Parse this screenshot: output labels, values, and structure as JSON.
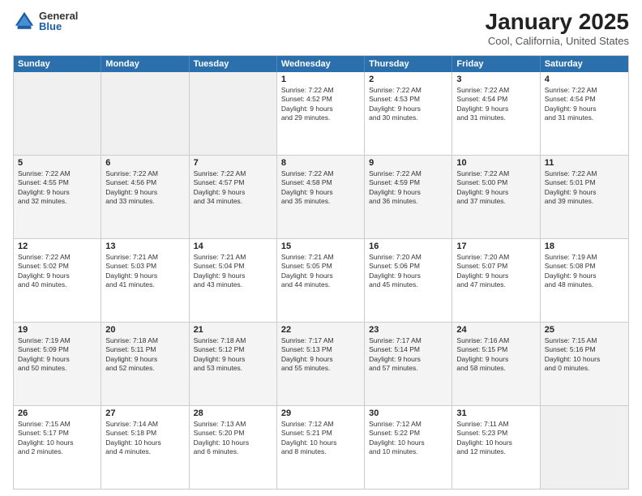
{
  "logo": {
    "general": "General",
    "blue": "Blue"
  },
  "title": "January 2025",
  "subtitle": "Cool, California, United States",
  "header_days": [
    "Sunday",
    "Monday",
    "Tuesday",
    "Wednesday",
    "Thursday",
    "Friday",
    "Saturday"
  ],
  "weeks": [
    [
      {
        "day": "",
        "text": ""
      },
      {
        "day": "",
        "text": ""
      },
      {
        "day": "",
        "text": ""
      },
      {
        "day": "1",
        "text": "Sunrise: 7:22 AM\nSunset: 4:52 PM\nDaylight: 9 hours\nand 29 minutes."
      },
      {
        "day": "2",
        "text": "Sunrise: 7:22 AM\nSunset: 4:53 PM\nDaylight: 9 hours\nand 30 minutes."
      },
      {
        "day": "3",
        "text": "Sunrise: 7:22 AM\nSunset: 4:54 PM\nDaylight: 9 hours\nand 31 minutes."
      },
      {
        "day": "4",
        "text": "Sunrise: 7:22 AM\nSunset: 4:54 PM\nDaylight: 9 hours\nand 31 minutes."
      }
    ],
    [
      {
        "day": "5",
        "text": "Sunrise: 7:22 AM\nSunset: 4:55 PM\nDaylight: 9 hours\nand 32 minutes."
      },
      {
        "day": "6",
        "text": "Sunrise: 7:22 AM\nSunset: 4:56 PM\nDaylight: 9 hours\nand 33 minutes."
      },
      {
        "day": "7",
        "text": "Sunrise: 7:22 AM\nSunset: 4:57 PM\nDaylight: 9 hours\nand 34 minutes."
      },
      {
        "day": "8",
        "text": "Sunrise: 7:22 AM\nSunset: 4:58 PM\nDaylight: 9 hours\nand 35 minutes."
      },
      {
        "day": "9",
        "text": "Sunrise: 7:22 AM\nSunset: 4:59 PM\nDaylight: 9 hours\nand 36 minutes."
      },
      {
        "day": "10",
        "text": "Sunrise: 7:22 AM\nSunset: 5:00 PM\nDaylight: 9 hours\nand 37 minutes."
      },
      {
        "day": "11",
        "text": "Sunrise: 7:22 AM\nSunset: 5:01 PM\nDaylight: 9 hours\nand 39 minutes."
      }
    ],
    [
      {
        "day": "12",
        "text": "Sunrise: 7:22 AM\nSunset: 5:02 PM\nDaylight: 9 hours\nand 40 minutes."
      },
      {
        "day": "13",
        "text": "Sunrise: 7:21 AM\nSunset: 5:03 PM\nDaylight: 9 hours\nand 41 minutes."
      },
      {
        "day": "14",
        "text": "Sunrise: 7:21 AM\nSunset: 5:04 PM\nDaylight: 9 hours\nand 43 minutes."
      },
      {
        "day": "15",
        "text": "Sunrise: 7:21 AM\nSunset: 5:05 PM\nDaylight: 9 hours\nand 44 minutes."
      },
      {
        "day": "16",
        "text": "Sunrise: 7:20 AM\nSunset: 5:06 PM\nDaylight: 9 hours\nand 45 minutes."
      },
      {
        "day": "17",
        "text": "Sunrise: 7:20 AM\nSunset: 5:07 PM\nDaylight: 9 hours\nand 47 minutes."
      },
      {
        "day": "18",
        "text": "Sunrise: 7:19 AM\nSunset: 5:08 PM\nDaylight: 9 hours\nand 48 minutes."
      }
    ],
    [
      {
        "day": "19",
        "text": "Sunrise: 7:19 AM\nSunset: 5:09 PM\nDaylight: 9 hours\nand 50 minutes."
      },
      {
        "day": "20",
        "text": "Sunrise: 7:18 AM\nSunset: 5:11 PM\nDaylight: 9 hours\nand 52 minutes."
      },
      {
        "day": "21",
        "text": "Sunrise: 7:18 AM\nSunset: 5:12 PM\nDaylight: 9 hours\nand 53 minutes."
      },
      {
        "day": "22",
        "text": "Sunrise: 7:17 AM\nSunset: 5:13 PM\nDaylight: 9 hours\nand 55 minutes."
      },
      {
        "day": "23",
        "text": "Sunrise: 7:17 AM\nSunset: 5:14 PM\nDaylight: 9 hours\nand 57 minutes."
      },
      {
        "day": "24",
        "text": "Sunrise: 7:16 AM\nSunset: 5:15 PM\nDaylight: 9 hours\nand 58 minutes."
      },
      {
        "day": "25",
        "text": "Sunrise: 7:15 AM\nSunset: 5:16 PM\nDaylight: 10 hours\nand 0 minutes."
      }
    ],
    [
      {
        "day": "26",
        "text": "Sunrise: 7:15 AM\nSunset: 5:17 PM\nDaylight: 10 hours\nand 2 minutes."
      },
      {
        "day": "27",
        "text": "Sunrise: 7:14 AM\nSunset: 5:18 PM\nDaylight: 10 hours\nand 4 minutes."
      },
      {
        "day": "28",
        "text": "Sunrise: 7:13 AM\nSunset: 5:20 PM\nDaylight: 10 hours\nand 6 minutes."
      },
      {
        "day": "29",
        "text": "Sunrise: 7:12 AM\nSunset: 5:21 PM\nDaylight: 10 hours\nand 8 minutes."
      },
      {
        "day": "30",
        "text": "Sunrise: 7:12 AM\nSunset: 5:22 PM\nDaylight: 10 hours\nand 10 minutes."
      },
      {
        "day": "31",
        "text": "Sunrise: 7:11 AM\nSunset: 5:23 PM\nDaylight: 10 hours\nand 12 minutes."
      },
      {
        "day": "",
        "text": ""
      }
    ]
  ]
}
